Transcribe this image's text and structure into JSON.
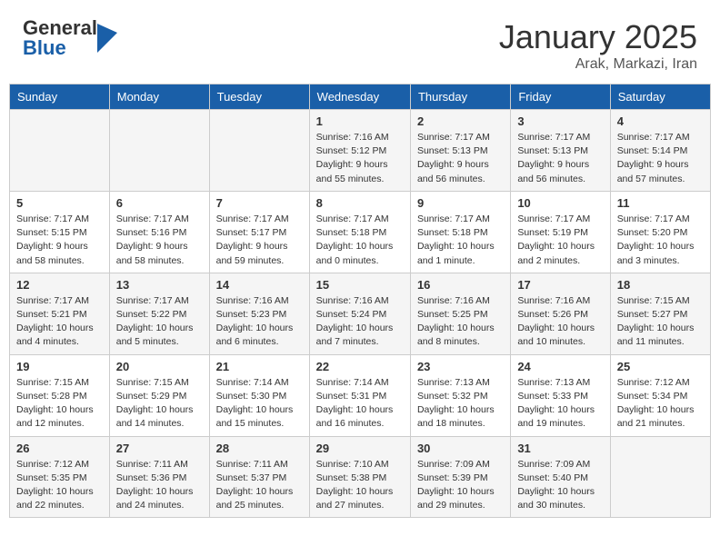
{
  "header": {
    "logo_line1": "General",
    "logo_line2": "Blue",
    "month": "January 2025",
    "location": "Arak, Markazi, Iran"
  },
  "weekdays": [
    "Sunday",
    "Monday",
    "Tuesday",
    "Wednesday",
    "Thursday",
    "Friday",
    "Saturday"
  ],
  "weeks": [
    [
      {
        "day": "",
        "info": ""
      },
      {
        "day": "",
        "info": ""
      },
      {
        "day": "",
        "info": ""
      },
      {
        "day": "1",
        "info": "Sunrise: 7:16 AM\nSunset: 5:12 PM\nDaylight: 9 hours\nand 55 minutes."
      },
      {
        "day": "2",
        "info": "Sunrise: 7:17 AM\nSunset: 5:13 PM\nDaylight: 9 hours\nand 56 minutes."
      },
      {
        "day": "3",
        "info": "Sunrise: 7:17 AM\nSunset: 5:13 PM\nDaylight: 9 hours\nand 56 minutes."
      },
      {
        "day": "4",
        "info": "Sunrise: 7:17 AM\nSunset: 5:14 PM\nDaylight: 9 hours\nand 57 minutes."
      }
    ],
    [
      {
        "day": "5",
        "info": "Sunrise: 7:17 AM\nSunset: 5:15 PM\nDaylight: 9 hours\nand 58 minutes."
      },
      {
        "day": "6",
        "info": "Sunrise: 7:17 AM\nSunset: 5:16 PM\nDaylight: 9 hours\nand 58 minutes."
      },
      {
        "day": "7",
        "info": "Sunrise: 7:17 AM\nSunset: 5:17 PM\nDaylight: 9 hours\nand 59 minutes."
      },
      {
        "day": "8",
        "info": "Sunrise: 7:17 AM\nSunset: 5:18 PM\nDaylight: 10 hours\nand 0 minutes."
      },
      {
        "day": "9",
        "info": "Sunrise: 7:17 AM\nSunset: 5:18 PM\nDaylight: 10 hours\nand 1 minute."
      },
      {
        "day": "10",
        "info": "Sunrise: 7:17 AM\nSunset: 5:19 PM\nDaylight: 10 hours\nand 2 minutes."
      },
      {
        "day": "11",
        "info": "Sunrise: 7:17 AM\nSunset: 5:20 PM\nDaylight: 10 hours\nand 3 minutes."
      }
    ],
    [
      {
        "day": "12",
        "info": "Sunrise: 7:17 AM\nSunset: 5:21 PM\nDaylight: 10 hours\nand 4 minutes."
      },
      {
        "day": "13",
        "info": "Sunrise: 7:17 AM\nSunset: 5:22 PM\nDaylight: 10 hours\nand 5 minutes."
      },
      {
        "day": "14",
        "info": "Sunrise: 7:16 AM\nSunset: 5:23 PM\nDaylight: 10 hours\nand 6 minutes."
      },
      {
        "day": "15",
        "info": "Sunrise: 7:16 AM\nSunset: 5:24 PM\nDaylight: 10 hours\nand 7 minutes."
      },
      {
        "day": "16",
        "info": "Sunrise: 7:16 AM\nSunset: 5:25 PM\nDaylight: 10 hours\nand 8 minutes."
      },
      {
        "day": "17",
        "info": "Sunrise: 7:16 AM\nSunset: 5:26 PM\nDaylight: 10 hours\nand 10 minutes."
      },
      {
        "day": "18",
        "info": "Sunrise: 7:15 AM\nSunset: 5:27 PM\nDaylight: 10 hours\nand 11 minutes."
      }
    ],
    [
      {
        "day": "19",
        "info": "Sunrise: 7:15 AM\nSunset: 5:28 PM\nDaylight: 10 hours\nand 12 minutes."
      },
      {
        "day": "20",
        "info": "Sunrise: 7:15 AM\nSunset: 5:29 PM\nDaylight: 10 hours\nand 14 minutes."
      },
      {
        "day": "21",
        "info": "Sunrise: 7:14 AM\nSunset: 5:30 PM\nDaylight: 10 hours\nand 15 minutes."
      },
      {
        "day": "22",
        "info": "Sunrise: 7:14 AM\nSunset: 5:31 PM\nDaylight: 10 hours\nand 16 minutes."
      },
      {
        "day": "23",
        "info": "Sunrise: 7:13 AM\nSunset: 5:32 PM\nDaylight: 10 hours\nand 18 minutes."
      },
      {
        "day": "24",
        "info": "Sunrise: 7:13 AM\nSunset: 5:33 PM\nDaylight: 10 hours\nand 19 minutes."
      },
      {
        "day": "25",
        "info": "Sunrise: 7:12 AM\nSunset: 5:34 PM\nDaylight: 10 hours\nand 21 minutes."
      }
    ],
    [
      {
        "day": "26",
        "info": "Sunrise: 7:12 AM\nSunset: 5:35 PM\nDaylight: 10 hours\nand 22 minutes."
      },
      {
        "day": "27",
        "info": "Sunrise: 7:11 AM\nSunset: 5:36 PM\nDaylight: 10 hours\nand 24 minutes."
      },
      {
        "day": "28",
        "info": "Sunrise: 7:11 AM\nSunset: 5:37 PM\nDaylight: 10 hours\nand 25 minutes."
      },
      {
        "day": "29",
        "info": "Sunrise: 7:10 AM\nSunset: 5:38 PM\nDaylight: 10 hours\nand 27 minutes."
      },
      {
        "day": "30",
        "info": "Sunrise: 7:09 AM\nSunset: 5:39 PM\nDaylight: 10 hours\nand 29 minutes."
      },
      {
        "day": "31",
        "info": "Sunrise: 7:09 AM\nSunset: 5:40 PM\nDaylight: 10 hours\nand 30 minutes."
      },
      {
        "day": "",
        "info": ""
      }
    ]
  ]
}
